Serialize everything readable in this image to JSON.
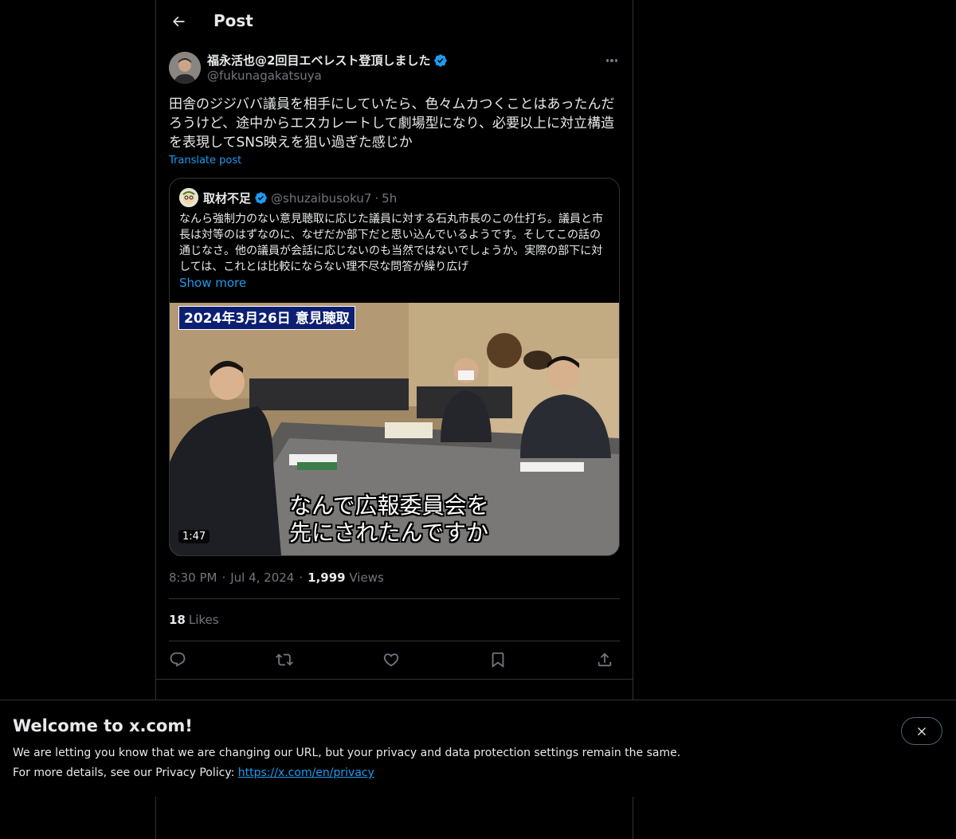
{
  "header": {
    "title": "Post"
  },
  "post": {
    "author_name": "福永活也@2回目エベレスト登頂しました",
    "author_handle": "@fukunagakatsuya",
    "text": "田舎のジジババ議員を相手にしていたら、色々ムカつくことはあったんだろうけど、途中からエスカレートして劇場型になり、必要以上に対立構造を表現してSNS映えを狙い過ぎた感じか",
    "translate_label": "Translate post",
    "time": "8:30 PM",
    "date": "Jul 4, 2024",
    "views_count": "1,999",
    "views_label": "Views",
    "likes_count": "18",
    "likes_label": "Likes"
  },
  "quote": {
    "name": "取材不足",
    "handle": "@shuzaibusoku7",
    "time": "5h",
    "text": "なんら強制力のない意見聴取に応じた議員に対する石丸市長のこの仕打ち。議員と市長は対等のはずなのに、なぜだか部下だと思い込んでいるようです。そしてこの話の通じなさ。他の議員が会話に応じないのも当然ではないでしょうか。実際の部下に対しては、これとは比較にならない理不尽な問答が繰り広げ",
    "show_more": "Show more",
    "video": {
      "date_caption": "2024年3月26日 意見聴取",
      "subtitle_line1": "なんで広報委員会を",
      "subtitle_line2": "先にされたんですか",
      "duration": "1:47"
    }
  },
  "banner": {
    "title": "Welcome to x.com!",
    "line1": "We are letting you know that we are changing our URL, but your privacy and data protection settings remain the same.",
    "line2_prefix": "For more details, see our Privacy Policy: ",
    "link": "https://x.com/en/privacy"
  },
  "colors": {
    "accent": "#1d9bf0",
    "text": "#e7e9ea",
    "muted": "#71767b",
    "border": "#2f3336"
  },
  "icons": [
    "back-arrow-icon",
    "verified-badge-icon",
    "more-icon",
    "reply-icon",
    "retweet-icon",
    "like-icon",
    "bookmark-icon",
    "share-icon",
    "close-icon"
  ]
}
